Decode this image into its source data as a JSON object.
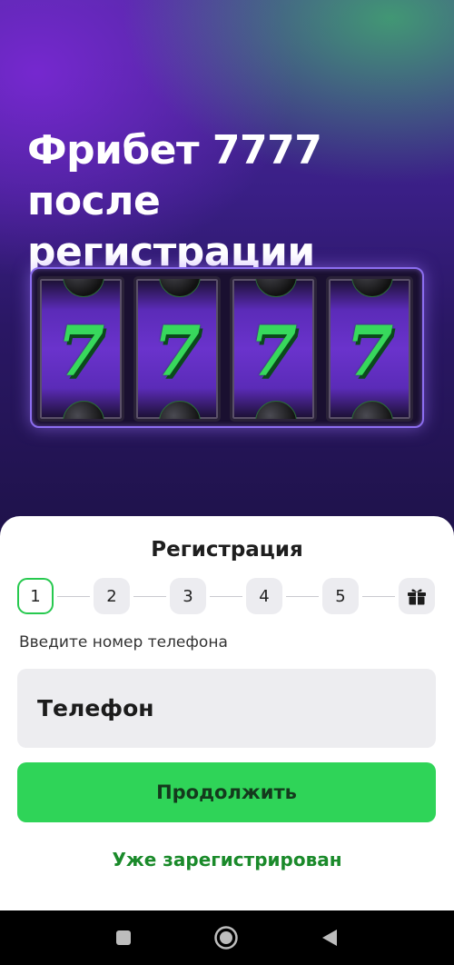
{
  "hero": {
    "title_lines": [
      "Фрибет 7777",
      "после",
      "регистрации"
    ],
    "reels": [
      {
        "symbol": "7",
        "top_icon": "hockey-puck",
        "bottom_icon": "soccer-ball"
      },
      {
        "symbol": "7",
        "top_icon": "hockey-puck",
        "bottom_icon": "soccer-ball"
      },
      {
        "symbol": "7",
        "top_icon": "soccer-ball",
        "bottom_icon": "basketball"
      },
      {
        "symbol": "7",
        "top_icon": "basketball",
        "bottom_icon": "hockey-puck"
      }
    ]
  },
  "registration": {
    "title": "Регистрация",
    "steps": [
      "1",
      "2",
      "3",
      "4",
      "5"
    ],
    "final_step_icon": "gift-icon",
    "active_step": 1,
    "field_label": "Введите номер телефона",
    "phone_placeholder": "Телефон",
    "phone_value": "",
    "continue_label": "Продолжить",
    "login_link": "Уже зарегистрирован"
  },
  "navbar": {
    "buttons": [
      "recents-square-icon",
      "home-circle-icon",
      "back-triangle-icon"
    ]
  },
  "colors": {
    "accent_green": "#2fd458",
    "link_green": "#1a8a2a",
    "hero_purple": "#3a1f86"
  }
}
